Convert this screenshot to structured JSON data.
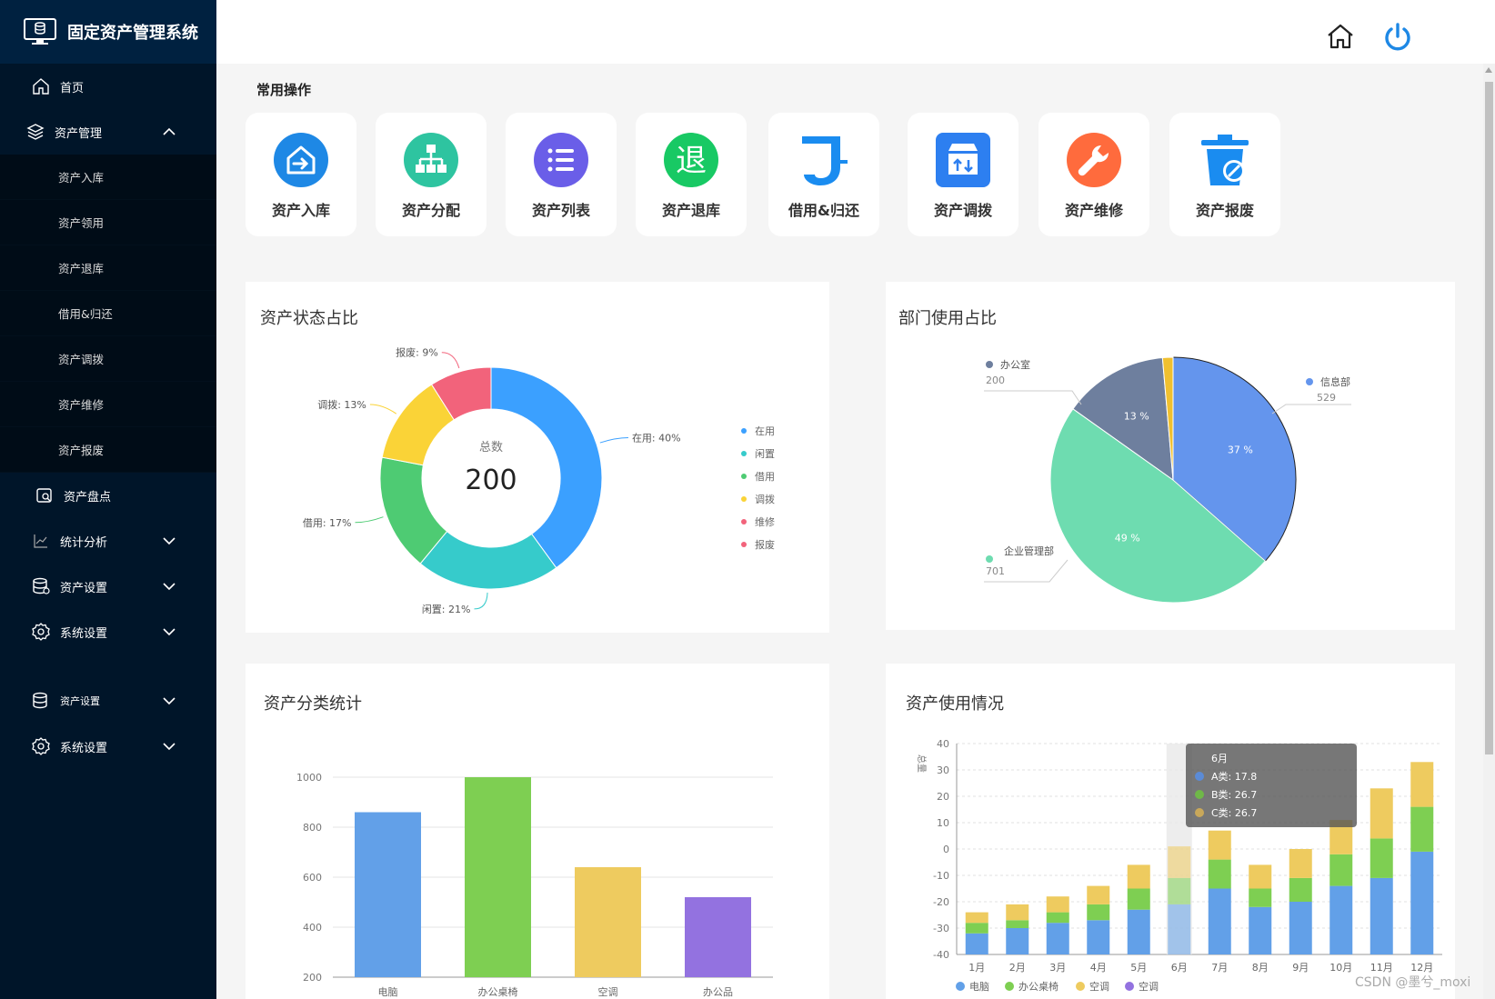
{
  "app": {
    "title": "固定资产管理系统"
  },
  "sidebar": {
    "home": "首页",
    "asset_mgmt": "资产管理",
    "sub_items": [
      "资产入库",
      "资产领用",
      "资产退库",
      "借用&归还",
      "资产调拨",
      "资产维修",
      "资产报废"
    ],
    "inventory": "资产盘点",
    "stats": "统计分析",
    "asset_settings": "资产设置",
    "system_settings": "系统设置",
    "asset_settings_2": "资产设置",
    "system_settings_2": "系统设置"
  },
  "quick_ops": {
    "title": "常用操作",
    "items": [
      {
        "label": "资产入库",
        "icon": "asset-in-icon",
        "color": "#1e88e5"
      },
      {
        "label": "资产分配",
        "icon": "org-tree-icon",
        "color": "#2ec4a0"
      },
      {
        "label": "资产列表",
        "icon": "list-icon",
        "color": "#6a5ee8"
      },
      {
        "label": "资产退库",
        "icon": "return-icon",
        "color": "#18c964"
      },
      {
        "label": "借用&归还",
        "icon": "borrow-icon",
        "color": "#1a8cf0"
      },
      {
        "label": "资产调拨",
        "icon": "transfer-box-icon",
        "color": "#2d7ff0"
      },
      {
        "label": "资产维修",
        "icon": "wrench-icon",
        "color": "#ff6b3d"
      },
      {
        "label": "资产报废",
        "icon": "trash-icon",
        "color": "#1a8cf0"
      }
    ]
  },
  "panels": {
    "status": "资产状态占比",
    "dept": "部门使用占比",
    "category": "资产分类统计",
    "usage": "资产使用情况"
  },
  "chart_data": [
    {
      "type": "pie",
      "title": "资产状态占比",
      "center_label": "总数",
      "center_value": "200",
      "slices": [
        {
          "name": "在用",
          "value": 40,
          "label": "在用: 40%",
          "color": "#3ba0ff"
        },
        {
          "name": "闲置",
          "value": 21,
          "label": "闲置: 21%",
          "color": "#36cbcb"
        },
        {
          "name": "借用",
          "value": 17,
          "label": "借用: 17%",
          "color": "#4ecb73"
        },
        {
          "name": "调拨",
          "value": 13,
          "label": "调拨: 13%",
          "color": "#fad337"
        },
        {
          "name": "维修",
          "value": 0,
          "label": "",
          "color": "#f2637b"
        },
        {
          "name": "报废",
          "value": 9,
          "label": "报废: 9%",
          "color": "#f2637b"
        }
      ],
      "legend": [
        "在用",
        "闲置",
        "借用",
        "调拨",
        "维修",
        "报废"
      ],
      "legend_colors": [
        "#3ba0ff",
        "#36cbcb",
        "#4ecb73",
        "#fad337",
        "#f2637b",
        "#f2637b"
      ]
    },
    {
      "type": "pie",
      "title": "部门使用占比",
      "slices": [
        {
          "name": "信息部",
          "value": 529,
          "pct": "37 %",
          "color": "#6495ed"
        },
        {
          "name": "企业管理部",
          "value": 701,
          "pct": "49 %",
          "color": "#6edcb0"
        },
        {
          "name": "办公室",
          "value": 200,
          "pct": "13 %",
          "color": "#6e7f9e"
        },
        {
          "name": "",
          "value": 20,
          "pct": "",
          "color": "#f0c030"
        }
      ],
      "labels": [
        {
          "name": "信息部",
          "value": "529"
        },
        {
          "name": "企业管理部",
          "value": "701"
        },
        {
          "name": "办公室",
          "value": "200"
        }
      ]
    },
    {
      "type": "bar",
      "title": "资产分类统计",
      "categories": [
        "电脑",
        "办公桌椅",
        "空调",
        "办公品"
      ],
      "values": [
        860,
        1000,
        640,
        520
      ],
      "colors": [
        "#62a0e8",
        "#7ecf52",
        "#eecb5f",
        "#9372e0"
      ],
      "y_ticks": [
        "200",
        "400",
        "600",
        "800",
        "1000"
      ],
      "ylim": [
        200,
        1000
      ]
    },
    {
      "type": "bar",
      "title": "资产使用情况",
      "stacked": true,
      "categories": [
        "1月",
        "2月",
        "3月",
        "4月",
        "5月",
        "6月",
        "7月",
        "8月",
        "9月",
        "10月",
        "11月",
        "12月"
      ],
      "ylabel": "总量",
      "y_ticks": [
        "40",
        "30",
        "20",
        "10",
        "0",
        "-10",
        "-20",
        "-30",
        "-40"
      ],
      "ylim": [
        -40,
        40
      ],
      "series": [
        {
          "name": "A类",
          "values": [
            -32,
            -30,
            -28,
            -27,
            -23,
            -21,
            -15,
            -22,
            -20,
            -14,
            -11,
            -1
          ],
          "color": "#62a0e8"
        },
        {
          "name": "B类",
          "values": [
            4,
            3,
            4,
            6,
            8,
            10,
            11,
            7,
            9,
            12,
            15,
            17
          ],
          "color": "#7ecf52"
        },
        {
          "name": "C类",
          "values": [
            4,
            6,
            6,
            7,
            9,
            12,
            11,
            9,
            11,
            13,
            19,
            17
          ],
          "color": "#eecb5f"
        }
      ],
      "legend": [
        {
          "name": "电脑",
          "color": "#62a0e8"
        },
        {
          "name": "办公桌椅",
          "color": "#7ecf52"
        },
        {
          "name": "空调",
          "color": "#eecb5f"
        },
        {
          "name": "空调",
          "color": "#9372e0"
        }
      ],
      "tooltip": {
        "title": "6月",
        "rows": [
          {
            "label": "A类:  17.8",
            "color": "#5b8bd6"
          },
          {
            "label": "B类:  26.7",
            "color": "#6fb848"
          },
          {
            "label": "C类:  26.7",
            "color": "#c9a85a"
          }
        ]
      },
      "highlight_index": 5
    }
  ],
  "watermark": "CSDN @墨兮_moxi"
}
